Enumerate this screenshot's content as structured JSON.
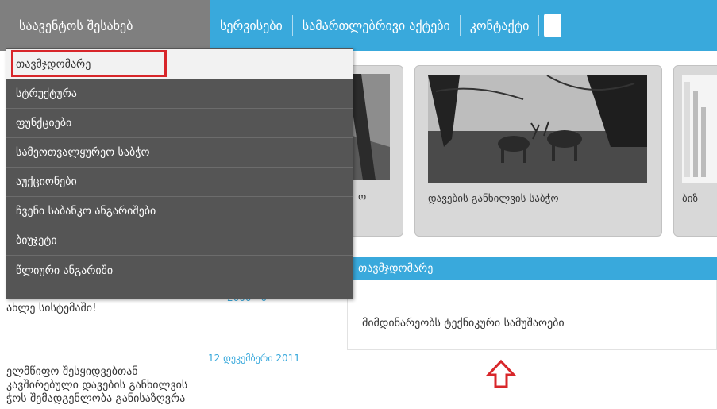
{
  "nav": {
    "tabs": [
      {
        "label": "საავენტოს შესახებ"
      },
      {
        "label": "სერვისები"
      },
      {
        "label": "სამართლებრივი აქტები"
      },
      {
        "label": "კონტაქტი"
      }
    ]
  },
  "dropdown": {
    "items": [
      {
        "label": "თავმჯდომარე"
      },
      {
        "label": "სტრუქტურა"
      },
      {
        "label": "ფუნქციები"
      },
      {
        "label": "სამეოთვალყურეო საბჭო"
      },
      {
        "label": "აუქციონები"
      },
      {
        "label": "ჩვენი საბანკო ანგარიშები"
      },
      {
        "label": "ბიუჯეტი"
      },
      {
        "label": "წლიური ანგარიში"
      }
    ]
  },
  "cards": [
    {
      "caption": "ო"
    },
    {
      "caption": "დავების განხილვის საბჭო"
    },
    {
      "caption": "ბიზ"
    }
  ],
  "section": {
    "title": "თავმჯდომარე",
    "status": "მიმდინარეობს ტექნიკური სამუშაოები"
  },
  "news": {
    "item1": {
      "date": "2000 - 0",
      "text": "ახლე სისტემაში!"
    },
    "item2": {
      "date": "12 დეკემბერი 2011",
      "lines": [
        "ელმწიფო შესყიდვებთან",
        "კავშირებული დავების განხილვის",
        "ჭოს შემადგენლობა განისაზღვრა"
      ]
    }
  },
  "colors": {
    "accent": "#39a9dc",
    "menu_bg": "#555555",
    "highlight": "#d8262a"
  }
}
